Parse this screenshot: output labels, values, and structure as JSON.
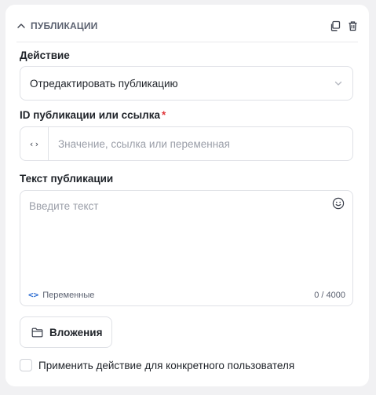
{
  "section": {
    "title": "ПУБЛИКАЦИИ",
    "icons": {
      "collapse": "chevron-up-icon",
      "duplicate": "copy-icon",
      "delete": "trash-icon"
    }
  },
  "action": {
    "label": "Действие",
    "selected": "Отредактировать публикацию"
  },
  "publication_id": {
    "label": "ID публикации или ссылка",
    "required_mark": "*",
    "prefix": "‹›",
    "placeholder": "Значение, ссылка или переменная",
    "value": ""
  },
  "publication_text": {
    "label": "Текст публикации",
    "placeholder": "Введите текст",
    "value": "",
    "variables_label": "Переменные",
    "counter": "0 / 4000"
  },
  "attachments": {
    "label": "Вложения"
  },
  "specific_user": {
    "label": "Применить действие для конкретного пользователя",
    "checked": false
  },
  "colors": {
    "accent": "#2a6bd1",
    "required": "#e0363a",
    "border": "#dfe1e6",
    "background": "#f1f1f3"
  }
}
